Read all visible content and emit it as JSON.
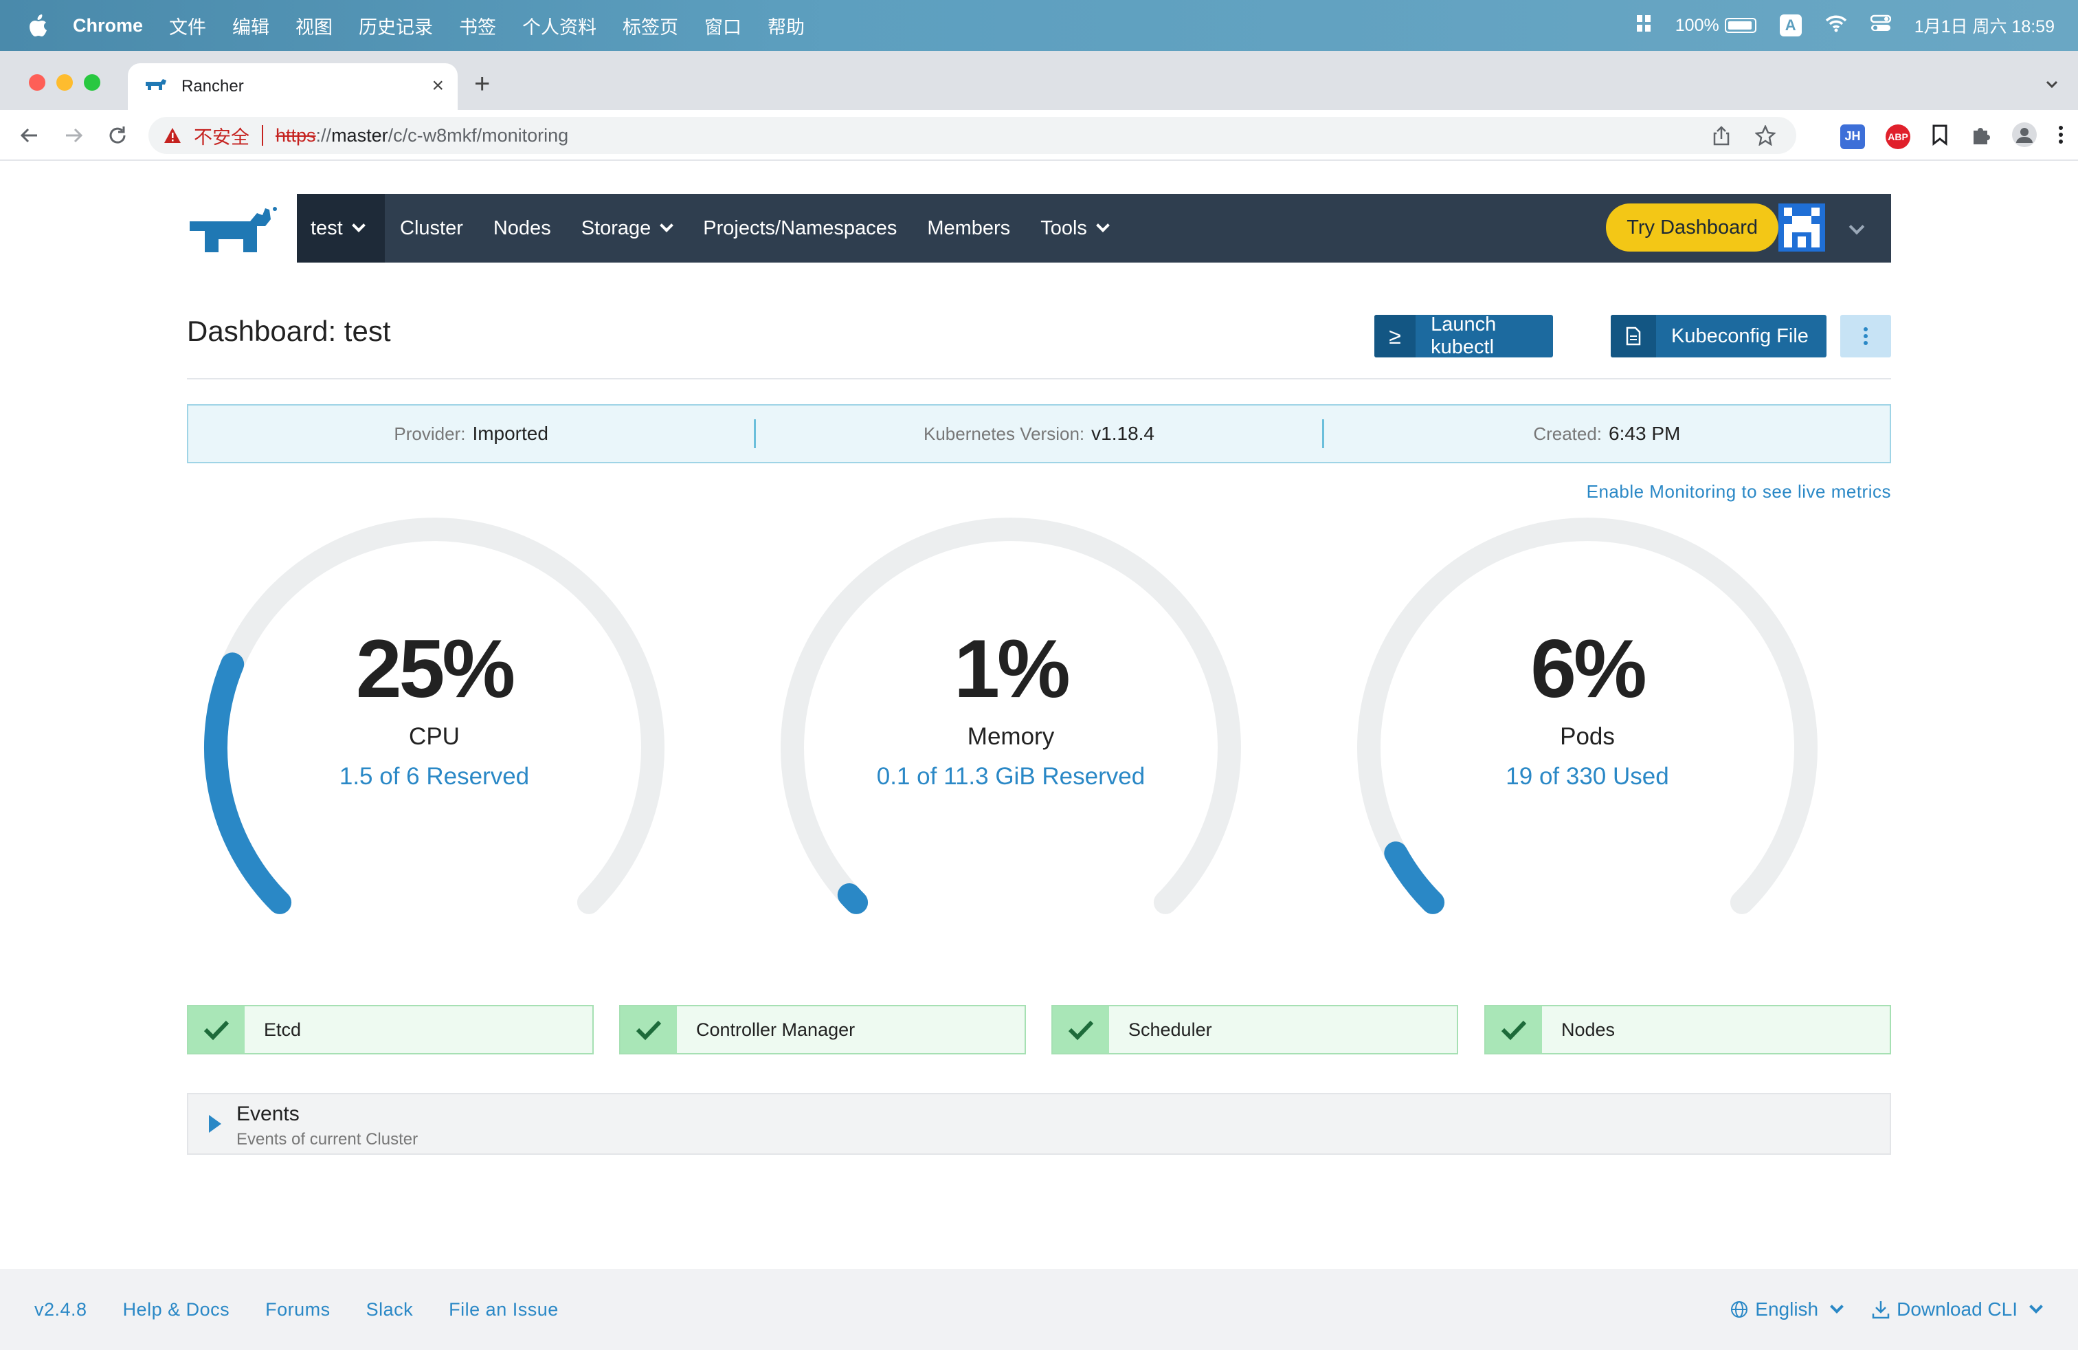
{
  "menubar": {
    "app": "Chrome",
    "items": [
      "文件",
      "编辑",
      "视图",
      "历史记录",
      "书签",
      "个人资料",
      "标签页",
      "窗口",
      "帮助"
    ],
    "battery": "100%",
    "input_method": "A",
    "datetime": "1月1日 周六  18:59"
  },
  "browser": {
    "tab_title": "Rancher",
    "security_label": "不安全",
    "url_scheme": "https",
    "url_sep": "://",
    "url_host": "master",
    "url_path": "/c/c-w8mkf/monitoring",
    "ext_jh": "JH",
    "ext_abp": "ABP"
  },
  "nav": {
    "project": "test",
    "items": [
      "Cluster",
      "Nodes",
      "Storage",
      "Projects/Namespaces",
      "Members",
      "Tools"
    ],
    "try_dashboard": "Try Dashboard"
  },
  "page": {
    "title": "Dashboard: test",
    "launch_kubectl": "Launch kubectl",
    "kubeconfig": "Kubeconfig File",
    "kubectl_glyph": "≥"
  },
  "info": {
    "provider_label": "Provider:",
    "provider": "Imported",
    "k8s_label": "Kubernetes Version:",
    "k8s": "v1.18.4",
    "created_label": "Created:",
    "created": "6:43 PM"
  },
  "monitoring_link": "Enable Monitoring to see live metrics",
  "gauges": [
    {
      "pct": "25%",
      "name": "CPU",
      "sub": "1.5 of 6 Reserved",
      "value": 0.25
    },
    {
      "pct": "1%",
      "name": "Memory",
      "sub": "0.1 of 11.3 GiB Reserved",
      "value": 0.01
    },
    {
      "pct": "6%",
      "name": "Pods",
      "sub": "19 of 330 Used",
      "value": 0.06
    }
  ],
  "components": [
    "Etcd",
    "Controller Manager",
    "Scheduler",
    "Nodes"
  ],
  "events": {
    "title": "Events",
    "subtitle": "Events of current Cluster"
  },
  "footer": {
    "links": [
      "v2.4.8",
      "Help & Docs",
      "Forums",
      "Slack",
      "File an Issue"
    ],
    "language": "English",
    "download": "Download CLI"
  },
  "colors": {
    "accent": "#2a88c6",
    "gauge_track": "#eceeef",
    "gauge_fill": "#2a88c6",
    "nav_bg": "#2f3e4f",
    "try_bg": "#f3c716"
  }
}
